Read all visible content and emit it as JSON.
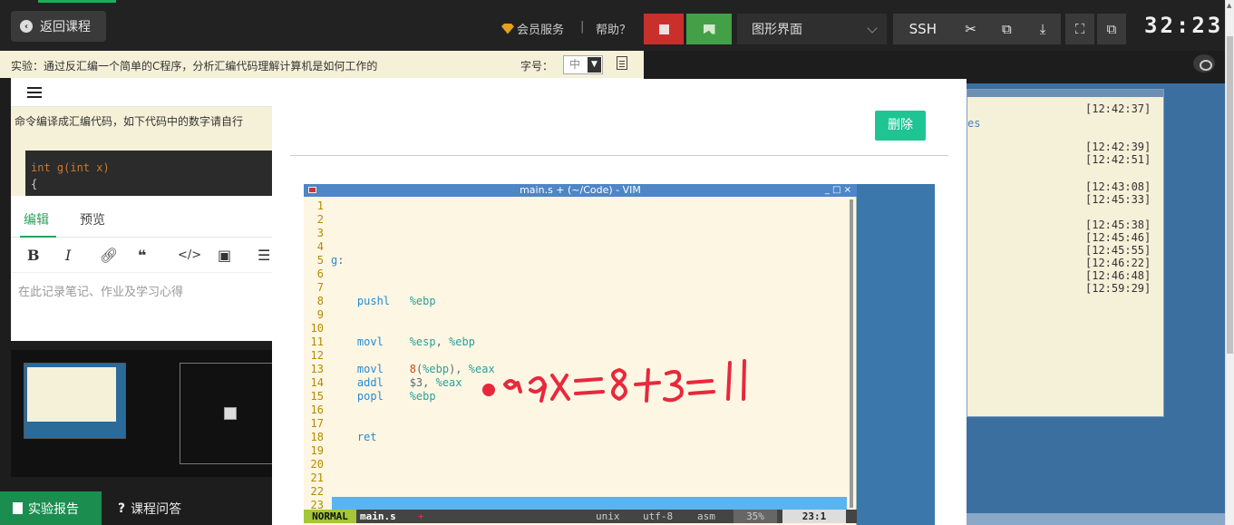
{
  "header": {
    "back_label": "返回课程",
    "vip_label": "会员服务",
    "separator": "|",
    "help_label": "帮助？",
    "gui_select": "图形界面",
    "ssh_label": "SSH",
    "timer": "32:23",
    "icons": [
      "stop-icon",
      "next-icon",
      "scissors-icon",
      "screen-icon",
      "download-icon",
      "fullscreen-icon",
      "popout-icon"
    ],
    "colors": {
      "stop": "#c9302c",
      "next": "#43a047",
      "accent": "#1aaf5d"
    }
  },
  "experiment": {
    "title": "实验：通过反汇编一个简单的C程序，分析汇编代码理解计算机是如何工作的",
    "font_label": "字号：",
    "font_value": "中",
    "description": "命令编译成汇编代码，如下代码中的数字请自行",
    "code_lines": [
      "int g(int x)",
      "{"
    ]
  },
  "editor": {
    "tab_edit": "编辑",
    "tab_preview": "预览",
    "toolbar": [
      "B",
      "I",
      "link-icon",
      "quote-icon",
      "code-icon",
      "image-icon",
      "list-icon"
    ],
    "placeholder": "在此记录笔记、作业及学习心得"
  },
  "footer": {
    "report_label": "实验报告",
    "qa_label": "课程问答"
  },
  "terminal": {
    "link_text": "es",
    "times": [
      "[12:42:37]",
      "[12:42:39]",
      "[12:42:51]",
      "[12:43:08]",
      "[12:45:33]",
      "[12:45:38]",
      "[12:45:46]",
      "[12:45:55]",
      "[12:46:22]",
      "[12:46:48]",
      "[12:59:29]"
    ]
  },
  "modal": {
    "delete_label": "删除",
    "vim": {
      "title": "main.s + (~/Code) - VIM",
      "controls": "_ □ ×",
      "lines": [
        {
          "n": "1",
          "parts": []
        },
        {
          "n": "2",
          "parts": []
        },
        {
          "n": "3",
          "parts": []
        },
        {
          "n": "4",
          "parts": []
        },
        {
          "n": "5",
          "parts": [
            {
              "c": "lbl",
              "t": "g"
            },
            {
              "c": "",
              "t": ":"
            }
          ]
        },
        {
          "n": "6",
          "parts": []
        },
        {
          "n": "7",
          "parts": []
        },
        {
          "n": "8",
          "parts": [
            {
              "c": "ins",
              "t": "    pushl   "
            },
            {
              "c": "reg",
              "t": "%ebp"
            }
          ]
        },
        {
          "n": "9",
          "parts": []
        },
        {
          "n": "10",
          "parts": []
        },
        {
          "n": "11",
          "parts": [
            {
              "c": "ins",
              "t": "    movl    "
            },
            {
              "c": "reg",
              "t": "%esp"
            },
            {
              "c": "",
              "t": ", "
            },
            {
              "c": "reg",
              "t": "%ebp"
            }
          ]
        },
        {
          "n": "12",
          "parts": []
        },
        {
          "n": "13",
          "parts": [
            {
              "c": "ins",
              "t": "    movl    "
            },
            {
              "c": "lit",
              "t": "8"
            },
            {
              "c": "",
              "t": "("
            },
            {
              "c": "reg",
              "t": "%ebp"
            },
            {
              "c": "",
              "t": "), "
            },
            {
              "c": "reg",
              "t": "%eax"
            }
          ]
        },
        {
          "n": "14",
          "parts": [
            {
              "c": "ins",
              "t": "    addl    "
            },
            {
              "c": "",
              "t": "$3, "
            },
            {
              "c": "reg",
              "t": "%eax"
            }
          ]
        },
        {
          "n": "15",
          "parts": [
            {
              "c": "ins",
              "t": "    popl    "
            },
            {
              "c": "reg",
              "t": "%ebp"
            }
          ]
        },
        {
          "n": "16",
          "parts": []
        },
        {
          "n": "17",
          "parts": []
        },
        {
          "n": "18",
          "parts": [
            {
              "c": "ins",
              "t": "    ret"
            }
          ]
        },
        {
          "n": "19",
          "parts": []
        },
        {
          "n": "20",
          "parts": []
        },
        {
          "n": "21",
          "parts": []
        },
        {
          "n": "22",
          "parts": []
        },
        {
          "n": "23",
          "parts": []
        }
      ],
      "status": {
        "mode": "NORMAL",
        "file": "main.s",
        "modified": "+",
        "fileformat": "unix",
        "encoding": "utf-8",
        "filetype": "asm",
        "percent": "35%",
        "position": "23:1"
      }
    },
    "annotation": "eax=8+3=11",
    "annotation_color": "#e8283c"
  }
}
